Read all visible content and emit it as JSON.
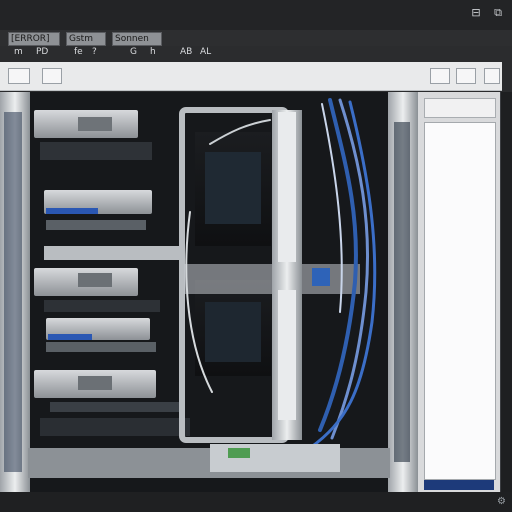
{
  "window": {
    "title_icons": [
      "minimize-icon",
      "restore-icon"
    ]
  },
  "menu": {
    "items": [
      "[ERROR]",
      "Gstm",
      "Sonnen"
    ]
  },
  "toolbar2": {
    "items": [
      "m",
      "PD",
      "fe",
      "?",
      "G",
      "h",
      "AB",
      "AL"
    ]
  },
  "ribbon": {
    "buttons": [
      "",
      "",
      "",
      ""
    ]
  },
  "panel": {
    "status_text": ""
  }
}
